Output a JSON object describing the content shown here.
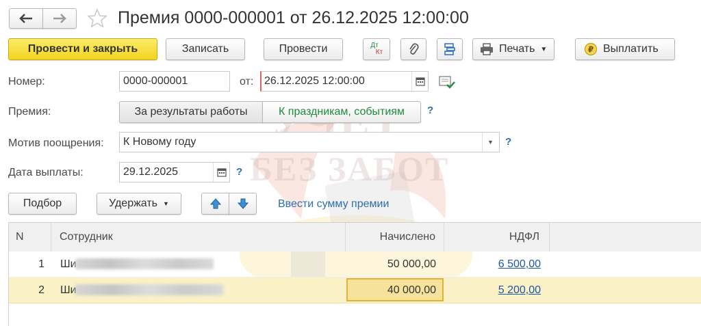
{
  "header": {
    "title": "Премия 0000-000001 от 26.12.2025 12:00:00"
  },
  "toolbar": {
    "post_close_label": "Провести и закрыть",
    "save_label": "Записать",
    "post_label": "Провести",
    "dt_kt_top": "Дт",
    "dt_kt_bottom": "Кт",
    "print_label": "Печать",
    "pay_label": "Выплатить"
  },
  "form": {
    "number_label": "Номер:",
    "number_value": "0000-000001",
    "from_label": "от:",
    "date_value": "26.12.2025 12:00:00",
    "bonus_label": "Премия:",
    "bonus_options": [
      "За результаты работы",
      "К праздникам, событиям"
    ],
    "motive_label": "Мотив поощрения:",
    "motive_value": "К Новому году",
    "payout_label": "Дата выплаты:",
    "payout_value": "29.12.2025",
    "help_mark": "?"
  },
  "actions": {
    "select_label": "Подбор",
    "withhold_label": "Удержать",
    "enter_sum_link": "Ввести сумму премии"
  },
  "table": {
    "columns": [
      "N",
      "Сотрудник",
      "Начислено",
      "НДФЛ"
    ],
    "rows": [
      {
        "n": "1",
        "employee_prefix": "Ши",
        "accrued": "50 000,00",
        "ndfl": "6 500,00"
      },
      {
        "n": "2",
        "employee_prefix": "Ши",
        "accrued": "40 000,00",
        "ndfl": "5 200,00"
      }
    ]
  },
  "watermark": {
    "line1": "УЧЕТ",
    "line2": "БЕЗ ЗАБОТ"
  },
  "colors": {
    "primary_button": "#f3d420",
    "link": "#1d56a5",
    "selected_row": "#fbf1c6",
    "active_cell_border": "#e0b23a",
    "option_active_text": "#1e8c3a"
  }
}
